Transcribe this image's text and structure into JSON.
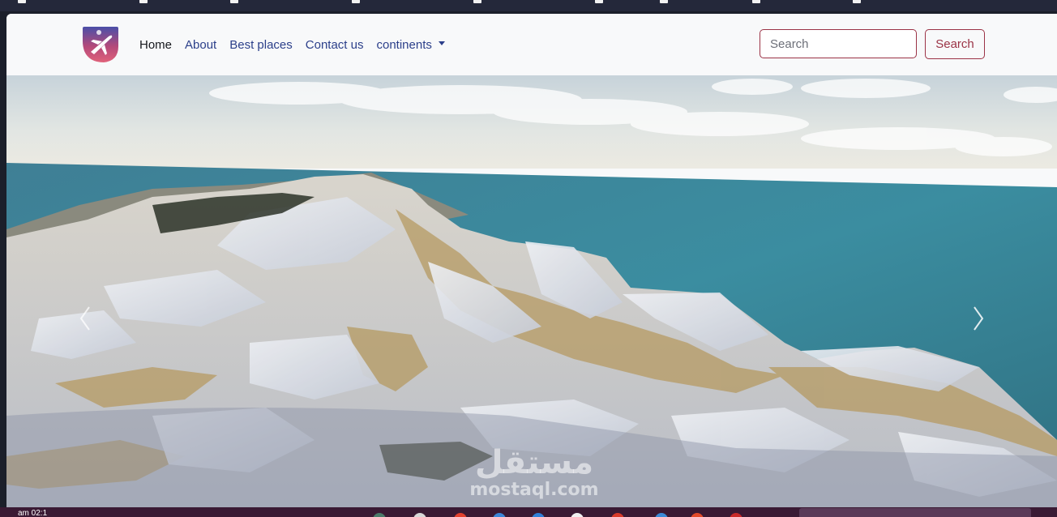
{
  "navbar": {
    "links": [
      {
        "label": "Home",
        "active": true
      },
      {
        "label": "About"
      },
      {
        "label": "Best places"
      },
      {
        "label": "Contact us"
      },
      {
        "label": "continents",
        "dropdown": true
      }
    ],
    "search": {
      "placeholder": "Search",
      "button_label": "Search"
    }
  },
  "colors": {
    "accent": "#9b3346",
    "nav_link": "#2b3f8a",
    "navbar_bg": "#f8f9fa"
  },
  "hero": {
    "watermark_ar": "مستقل",
    "watermark_en": "mostaql.com",
    "controls": [
      "chevron-left-icon",
      "chevron-right-icon"
    ]
  },
  "taskbar": {
    "clock": "am 02:1"
  }
}
